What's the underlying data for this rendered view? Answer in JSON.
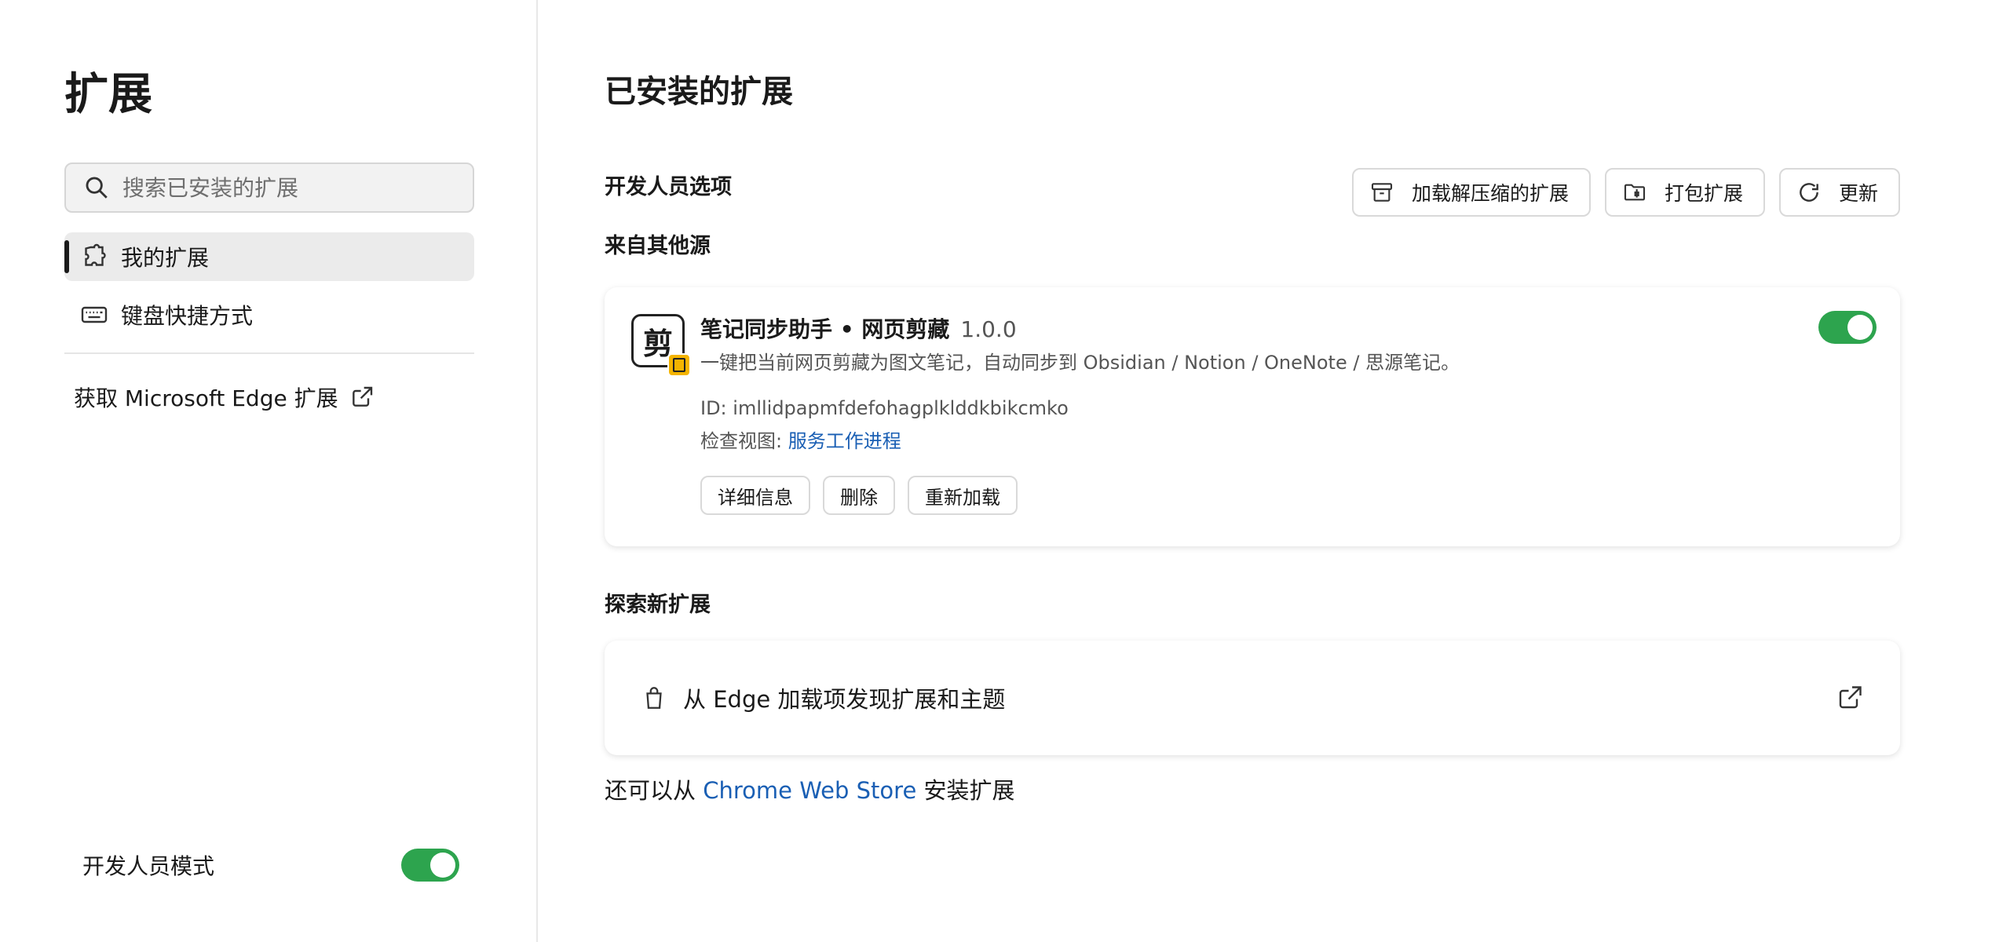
{
  "sidebar": {
    "title": "扩展",
    "search_placeholder": "搜索已安装的扩展",
    "nav": [
      {
        "label": "我的扩展",
        "icon": "puzzle-icon",
        "active": true
      },
      {
        "label": "键盘快捷方式",
        "icon": "keyboard-icon",
        "active": false
      }
    ],
    "get_extensions_label": "获取 Microsoft Edge 扩展",
    "developer_mode_label": "开发人员模式",
    "developer_mode_on": true
  },
  "main": {
    "title": "已安装的扩展",
    "developer_options_label": "开发人员选项",
    "toolbar": {
      "load_unpacked": "加载解压缩的扩展",
      "pack": "打包扩展",
      "update": "更新"
    },
    "from_other_sources_label": "来自其他源",
    "extension": {
      "logo_char": "剪",
      "name": "笔记同步助手 • 网页剪藏",
      "version": "1.0.0",
      "description": "一键把当前网页剪藏为图文笔记，自动同步到 Obsidian / Notion / OneNote / 思源笔记。",
      "id_line": "ID: imllidpapmfdefohagplklddkbikcmko",
      "inspect_prefix": "检查视图:",
      "inspect_link": "服务工作进程",
      "enabled": true,
      "actions": {
        "details": "详细信息",
        "remove": "删除",
        "reload": "重新加载"
      }
    },
    "explore_label": "探索新扩展",
    "explore_card_text": "从 Edge 加载项发现扩展和主题",
    "store_prefix": "还可以从",
    "store_link": "Chrome Web Store",
    "store_suffix": "安装扩展"
  },
  "colors": {
    "toggle_on": "#2da44e",
    "link": "#1a5fb4",
    "badge": "#f4b400"
  }
}
